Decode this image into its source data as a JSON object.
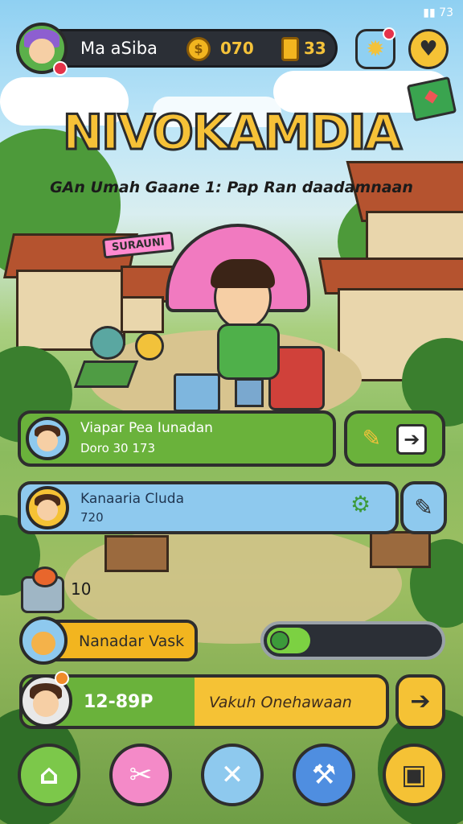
{
  "status_bar": {
    "signal": "73"
  },
  "player": {
    "name": "Ma aSiba",
    "coins": "070",
    "gold": "33"
  },
  "title": {
    "main": "NIVOKAMDIA",
    "subtitle": "GAn Umah Gaane 1: Pap Ran daadamnaan"
  },
  "scene": {
    "sign": "SURAUNI"
  },
  "cards": [
    {
      "name": "Viapar Pea Iunadan",
      "detail": "Doro 30 173"
    },
    {
      "name": "Kanaaria Cluda",
      "detail": "720"
    }
  ],
  "inventory": {
    "count": "10"
  },
  "task": {
    "label": "Nanadar Vask",
    "progress": 0.25
  },
  "bottom_panel": {
    "score": "12-89P",
    "action_label": "Vakuh Onehawaan"
  },
  "colors": {
    "green": "#6ab23b",
    "blue": "#8ec9ee",
    "yellow": "#f5c235",
    "pink": "#f48ac8"
  },
  "icons": {
    "settings": "gear-icon",
    "shop": "shop-icon",
    "leaf": "leaf-icon",
    "arrow": "arrow-right-icon",
    "tools": "tools-icon",
    "home": "home-icon",
    "craft": "crossed-tools-icon",
    "close": "close-icon",
    "build": "build-icon",
    "map": "map-icon"
  }
}
